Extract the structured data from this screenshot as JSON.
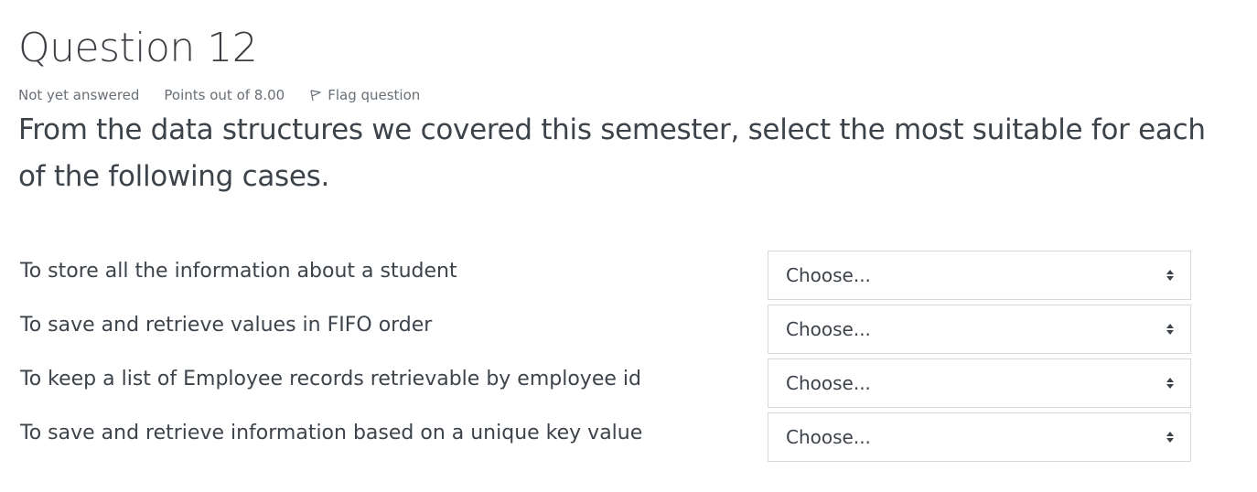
{
  "question": {
    "title": "Question 12",
    "status": "Not yet answered",
    "points": "Points out of 8.00",
    "flag_label": "Flag question",
    "flag_icon": "flag-icon",
    "text": "From the data structures we covered this semester, select the most suitable for each of the following cases."
  },
  "answers": [
    {
      "label": "To store all the information about a student",
      "selected": "Choose..."
    },
    {
      "label": "To save and retrieve values in FIFO order",
      "selected": "Choose..."
    },
    {
      "label": "To keep a list of Employee records retrievable by employee id",
      "selected": "Choose..."
    },
    {
      "label": "To save and retrieve information based on a unique key value",
      "selected": "Choose..."
    }
  ],
  "colors": {
    "text": "#3d434a",
    "meta": "#686f76",
    "border": "#d7d9db"
  }
}
